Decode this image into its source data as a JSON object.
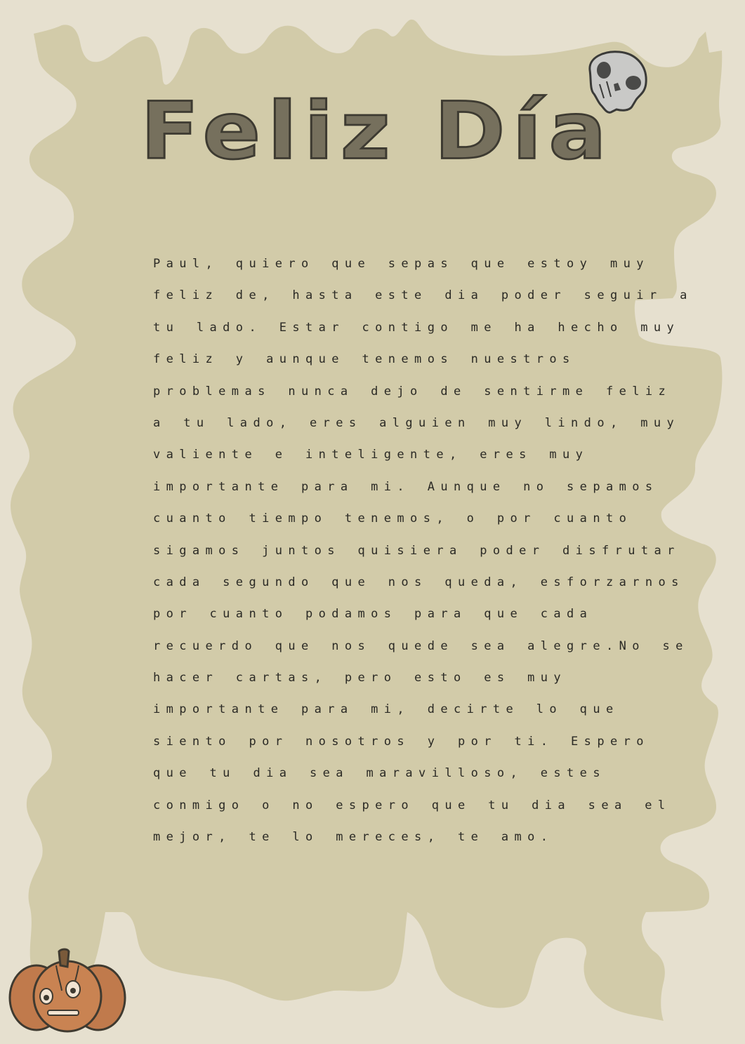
{
  "title": "Feliz Día",
  "letter": {
    "lines": [
      "Paul, quiero que sepas que estoy muy",
      "feliz de, hasta este dia poder seguir a",
      "tu lado. Estar contigo me ha hecho muy",
      "feliz y aunque tenemos nuestros",
      "problemas nunca dejo de sentirme feliz",
      "a tu lado, eres alguien muy lindo, muy",
      "valiente e inteligente, eres muy",
      "importante para mi. Aunque no sepamos",
      "cuanto tiempo tenemos, o por cuanto",
      "sigamos juntos quisiera poder disfrutar",
      "cada segundo que nos queda, esforzarnos",
      "por cuanto podamos para que cada",
      "recuerdo que nos quede sea alegre.No se",
      "hacer cartas, pero esto es muy",
      "importante para mi, decirte lo que",
      "siento por nosotros y por ti. Espero",
      "que tu dia sea maravilloso, estes",
      "conmigo o no espero que tu dia sea el",
      "mejor, te lo mereces, te amo."
    ]
  },
  "decorations": {
    "skull_icon": "skull-icon",
    "pumpkin_icon": "jack-o-lantern-icon"
  },
  "colors": {
    "background": "#e6e0cf",
    "paper": "#d2cba9",
    "title": "#76705d",
    "text": "#2b2a25",
    "skull": "#c9c9c7",
    "pumpkin": "#c07a4c"
  }
}
